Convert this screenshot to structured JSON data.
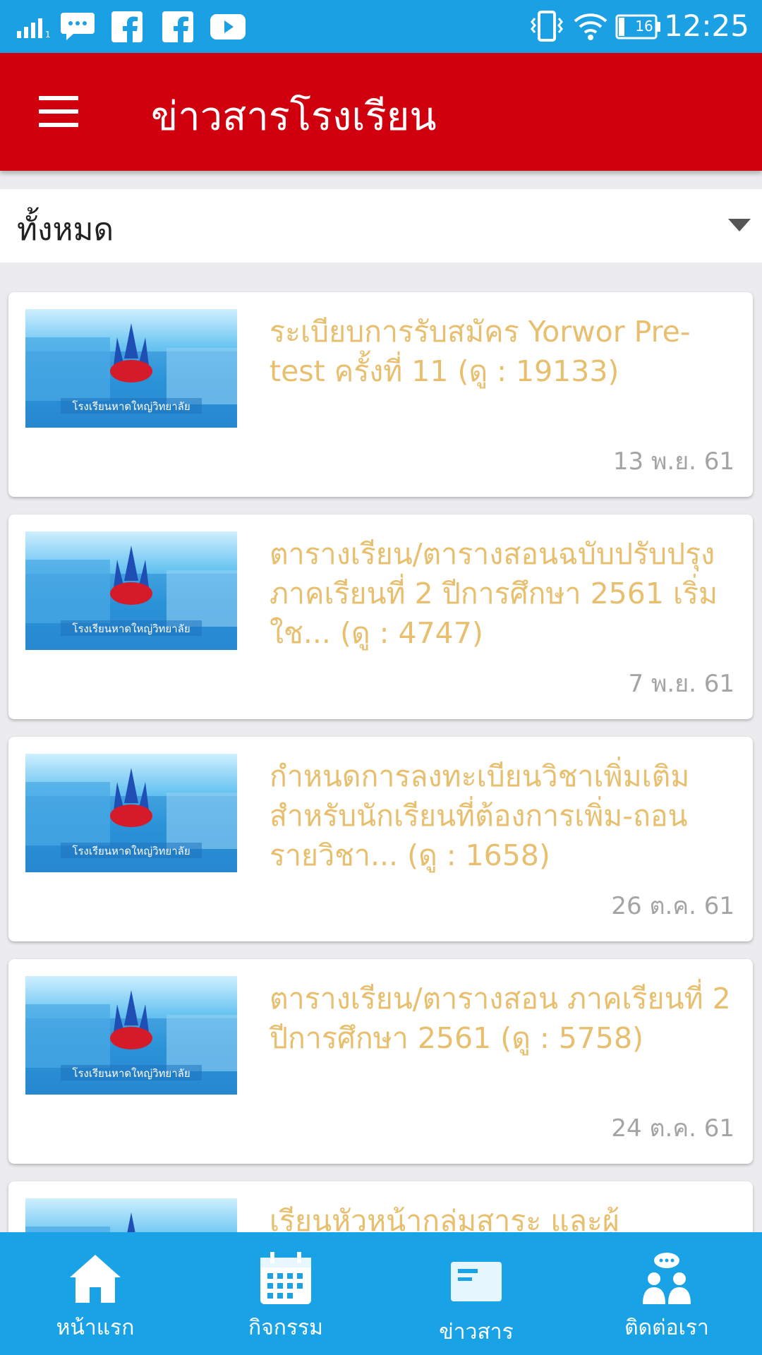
{
  "status_bar": {
    "time": "12:25",
    "battery": "16",
    "icons": [
      "signal-icon",
      "chat-icon",
      "facebook-icon",
      "facebook-icon",
      "youtube-icon",
      "vibrate-icon",
      "wifi-icon",
      "battery-icon"
    ]
  },
  "app_bar": {
    "title": "ข่าวสารโรงเรียน",
    "menu_icon": "hamburger-menu-icon"
  },
  "filter": {
    "selected": "ทั้งหมด"
  },
  "news": {
    "thumb_caption": "โรงเรียนหาดใหญ่วิทยาลัย",
    "items": [
      {
        "title": "ระเบียบการรับสมัคร Yorwor Pre-test ครั้งที่ 11 (ดู : 19133)",
        "date": "13 พ.ย. 61"
      },
      {
        "title": "ตารางเรียน/ตารางสอนฉบับปรับปรุง ภาคเรียนที่ 2 ปีการศึกษา 2561  เริ่มใช... (ดู : 4747)",
        "date": "7 พ.ย. 61"
      },
      {
        "title": "กำหนดการลงทะเบียนวิชาเพิ่มเติมสำหรับนักเรียนที่ต้องการเพิ่ม-ถอนรายวิชา... (ดู : 1658)",
        "date": "26 ต.ค. 61"
      },
      {
        "title": "ตารางเรียน/ตารางสอน ภาคเรียนที่ 2 ปีการศึกษา 2561 (ดู : 5758)",
        "date": "24 ต.ค. 61"
      },
      {
        "title": "เรียนหัวหน้ากลุ่มสาระ และผู้",
        "date": ""
      }
    ]
  },
  "colors": {
    "status_bar": "#1aa0e3",
    "app_bar": "#d0000e",
    "news_title": "#e8bf6e",
    "bottom_nav": "#19a2e6"
  },
  "bottom_nav": {
    "items": [
      {
        "label": "หน้าแรก",
        "icon": "home-icon"
      },
      {
        "label": "กิจกรรม",
        "icon": "calendar-icon"
      },
      {
        "label": "ข่าวสาร",
        "icon": "news-icon"
      },
      {
        "label": "ติดต่อเรา",
        "icon": "contact-icon"
      }
    ]
  }
}
